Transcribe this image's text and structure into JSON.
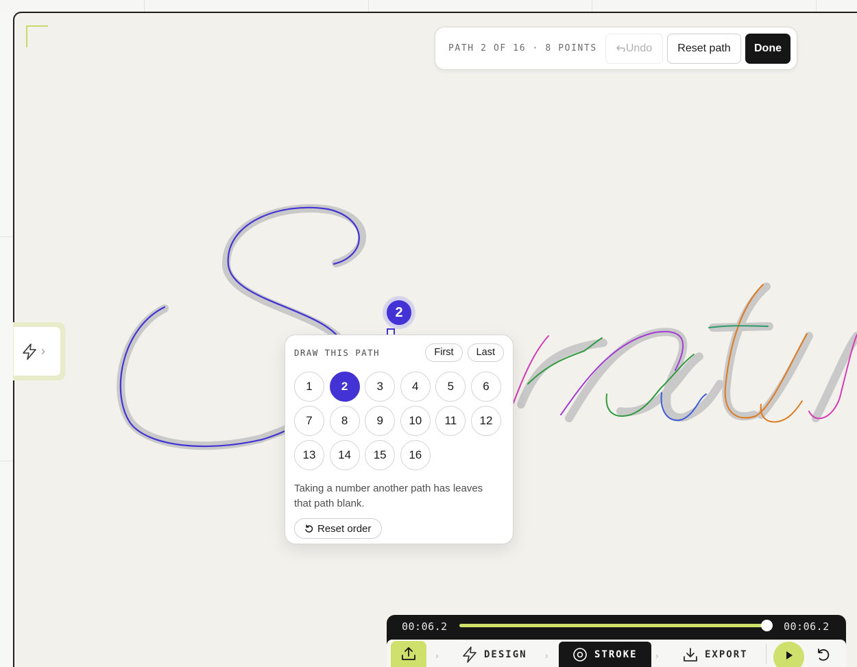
{
  "toolbar": {
    "path_status": "PATH 2 OF 16 · 8 POINTS",
    "undo_label": "Undo",
    "reset_path_label": "Reset path",
    "done_label": "Done"
  },
  "marker": {
    "number": "2"
  },
  "popover": {
    "title": "DRAW THIS PATH",
    "first_label": "First",
    "last_label": "Last",
    "numbers": [
      "1",
      "2",
      "3",
      "4",
      "5",
      "6",
      "7",
      "8",
      "9",
      "10",
      "11",
      "12",
      "13",
      "14",
      "15",
      "16"
    ],
    "active_number": "2",
    "note": "Taking a number another path has leaves that path blank.",
    "reset_order_label": "Reset order"
  },
  "timeline": {
    "time_current": "00:06.2",
    "time_total": "00:06.2",
    "progress": 1.0
  },
  "steps": {
    "design_label": "DESIGN",
    "stroke_label": "STROKE",
    "export_label": "EXPORT",
    "active": "STROKE"
  },
  "colors": {
    "accent": "#4333d4",
    "lime": "#cfe06c",
    "dark": "#161616",
    "path_colors": [
      "#4333d4",
      "#d63bb5",
      "#2f9a3f",
      "#a33ad6",
      "#3b5bd9",
      "#e07a1e",
      "#2f9a6a"
    ]
  },
  "icons": {
    "side_tab": "bolt-icon",
    "undo": "undo-arrow-icon",
    "reset_order": "rotate-icon",
    "upload": "upload-icon",
    "design": "bolt-icon",
    "stroke": "target-icon",
    "export": "download-icon",
    "play": "play-icon",
    "replay": "replay-icon"
  }
}
